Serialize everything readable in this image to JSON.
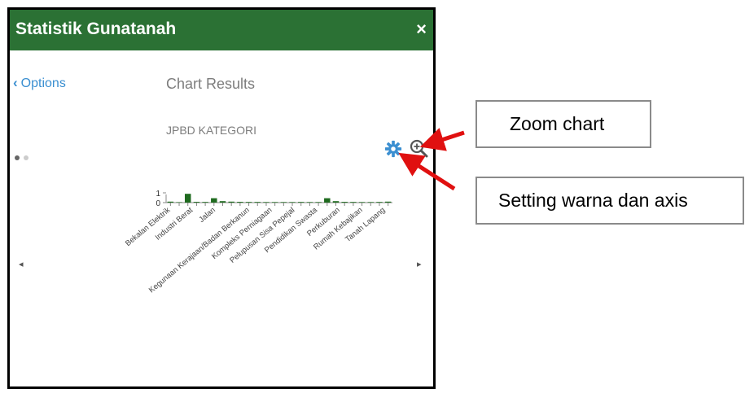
{
  "window": {
    "title": "Statistik Gunatanah",
    "close_glyph": "×"
  },
  "nav": {
    "back_label": "Options",
    "back_icon": "chevron-left-icon",
    "view_title": "Chart Results"
  },
  "toolbar": {
    "settings_icon": "gear-icon",
    "zoom_icon": "zoom-in-icon"
  },
  "pager": {
    "prev_glyph": "◂",
    "next_glyph": "▸"
  },
  "colors": {
    "header": "#2b7134",
    "link": "#3b8fd1",
    "bar": "#1f6b1f",
    "icon": "#3b8fd1",
    "arrow": "#e01010"
  },
  "chart_data": {
    "type": "bar",
    "title": "JPBD KATEGORI",
    "ylim": [
      0,
      1
    ],
    "y_ticks": [
      "0",
      "1"
    ],
    "grid": false,
    "categories": [
      "Bekalan Elektrik",
      "",
      "Industri Berat",
      "",
      "Jalan",
      "",
      "",
      "Kegunaan Kerajaan/Badan Berkanun",
      "",
      "Kompleks Perniagaan",
      "",
      "Pelupusan Sisa Pepejal",
      "",
      "Pendidikan Swasta",
      "",
      "Perkuburan",
      "",
      "Rumah Kebajikan",
      "",
      "Tanah Lapang"
    ],
    "values": [
      0.1,
      0.05,
      0.9,
      0.08,
      0.07,
      0.45,
      0.15,
      0.1,
      0.08,
      0.07,
      0.07,
      0.06,
      0.06,
      0.06,
      0.06,
      0.07,
      0.06,
      0.06,
      0.45,
      0.15,
      0.08,
      0.07,
      0.06,
      0.06,
      0.07,
      0.1
    ]
  },
  "annotations": {
    "zoom_label": "Zoom chart",
    "setting_label": "Setting warna dan axis"
  }
}
